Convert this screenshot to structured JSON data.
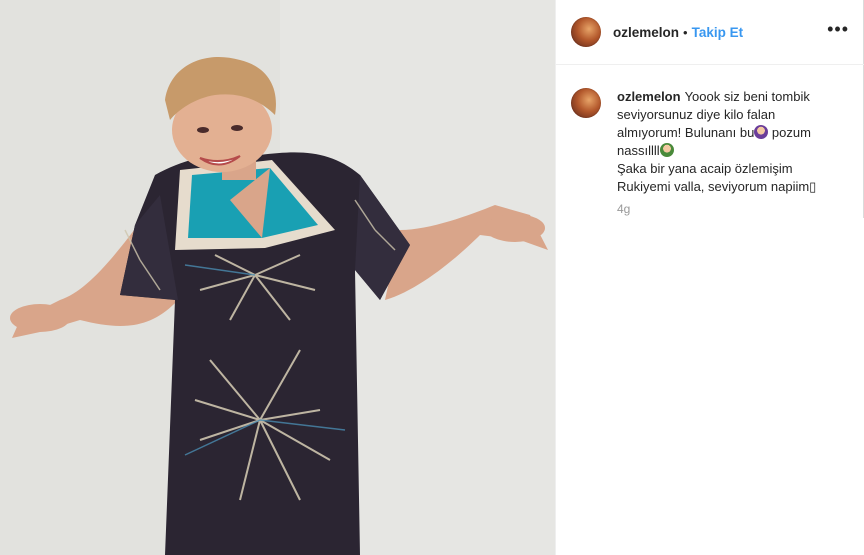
{
  "post": {
    "username": "ozlemelon",
    "separator": "•",
    "follow_label": "Takip Et",
    "more_label": "•••"
  },
  "caption": {
    "username": "ozlemelon",
    "line1": "Yoook siz beni tombik seviyorsunuz diye kilo falan almıyorum! Bulunanı bu",
    "line2": " pozum nassıllll",
    "line3": "Şaka bir yana acaip özlemişim Rukiyemi valla, seviyorum napiim",
    "trailing_glyph": "▯",
    "emoji1": "woman-shrugging-emoji",
    "emoji2": "woman-shrugging-emoji"
  },
  "timestamp": "4g",
  "colors": {
    "follow": "#3897f0",
    "text": "#262626",
    "muted": "#999999",
    "border": "#efefef"
  }
}
